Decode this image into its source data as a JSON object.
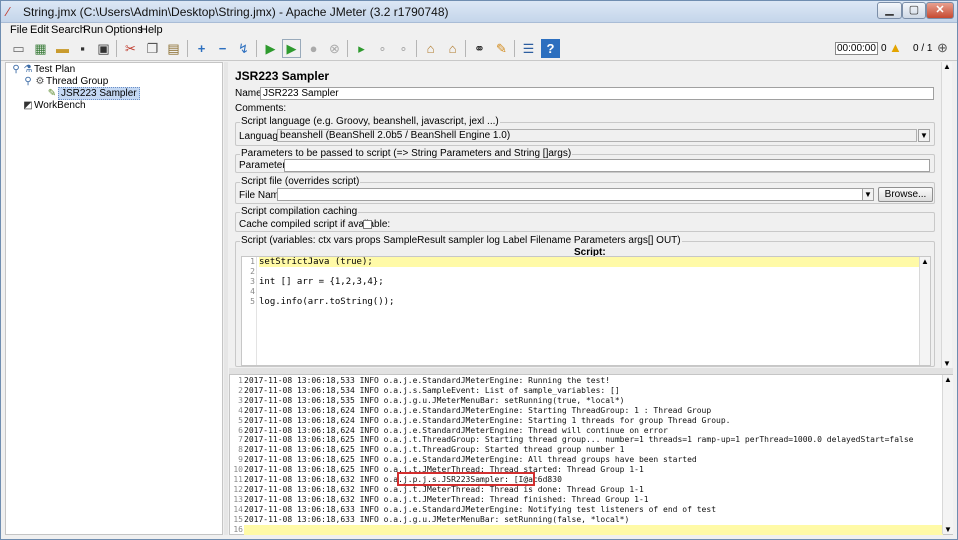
{
  "window": {
    "title": "String.jmx (C:\\Users\\Admin\\Desktop\\String.jmx) - Apache JMeter (3.2 r1790748)",
    "controls": {
      "minimize": "▁",
      "maximize": "▢",
      "close": "✕"
    }
  },
  "menu": [
    "File",
    "Edit",
    "Search",
    "Run",
    "Options",
    "Help"
  ],
  "toolbar": {
    "icons": [
      "new-icon",
      "templates-icon",
      "open-icon",
      "save-icon",
      "save-as-icon",
      "cut-icon",
      "copy-icon",
      "paste-icon",
      "expand-icon",
      "collapse-icon",
      "toggle-icon",
      "start-icon",
      "start-no-pause-icon",
      "stop-icon",
      "shutdown-icon",
      "remote-start-icon",
      "remote-stop-icon",
      "remote-shutdown-icon",
      "clear-icon",
      "clear-all-icon",
      "search-icon",
      "reset-search-icon",
      "function-helper-icon",
      "help-icon"
    ],
    "timer": "00:00:00",
    "warnings_count": "0",
    "threads": "0 / 1"
  },
  "tree": {
    "items": [
      {
        "label": "Test Plan",
        "icon": "test-plan-icon",
        "expander": "⚲"
      },
      {
        "label": "Thread Group",
        "icon": "thread-group-icon",
        "expander": "⚲"
      },
      {
        "label": "JSR223 Sampler",
        "icon": "sampler-icon"
      },
      {
        "label": "WorkBench",
        "icon": "workbench-icon"
      }
    ]
  },
  "sampler": {
    "title": "JSR223 Sampler",
    "name_label": "Name:",
    "name_value": "JSR223 Sampler",
    "comments_label": "Comments:",
    "language_group": "Script language (e.g. Groovy, beanshell, javascript, jexl ...)",
    "language_label": "Language:",
    "language_value": "beanshell     (BeanShell 2.0b5 / BeanShell Engine 1.0)",
    "params_group": "Parameters to be passed to script (=> String Parameters and String []args)",
    "params_label": "Parameters:",
    "file_group": "Script file (overrides script)",
    "file_label": "File Name:",
    "browse_label": "Browse...",
    "caching_group": "Script compilation caching",
    "cache_label": "Cache compiled script if available:",
    "script_group": "Script (variables: ctx vars props SampleResult sampler log Label Filename Parameters args[] OUT)",
    "script_header": "Script:"
  },
  "script_lines": [
    "setStrictJava (true);",
    "",
    "int [] arr = {1,2,3,4};",
    "",
    "log.info(arr.toString());"
  ],
  "log_lines": [
    "2017-11-08 13:06:18,533 INFO o.a.j.e.StandardJMeterEngine: Running the test!",
    "2017-11-08 13:06:18,534 INFO o.a.j.s.SampleEvent: List of sample_variables: []",
    "2017-11-08 13:06:18,535 INFO o.a.j.g.u.JMeterMenuBar: setRunning(true, *local*)",
    "2017-11-08 13:06:18,624 INFO o.a.j.e.StandardJMeterEngine: Starting ThreadGroup: 1 : Thread Group",
    "2017-11-08 13:06:18,624 INFO o.a.j.e.StandardJMeterEngine: Starting 1 threads for group Thread Group.",
    "2017-11-08 13:06:18,624 INFO o.a.j.e.StandardJMeterEngine: Thread will continue on error",
    "2017-11-08 13:06:18,625 INFO o.a.j.t.ThreadGroup: Starting thread group... number=1 threads=1 ramp-up=1 perThread=1000.0 delayedStart=false",
    "2017-11-08 13:06:18,625 INFO o.a.j.t.ThreadGroup: Started thread group number 1",
    "2017-11-08 13:06:18,625 INFO o.a.j.e.StandardJMeterEngine: All thread groups have been started",
    "2017-11-08 13:06:18,625 INFO o.a.j.t.JMeterThread: Thread started: Thread Group 1-1",
    "2017-11-08 13:06:18,632 INFO o.a.j.p.j.s.JSR223Sampler: [I@ac6d830",
    "2017-11-08 13:06:18,632 INFO o.a.j.t.JMeterThread: Thread is done: Thread Group 1-1",
    "2017-11-08 13:06:18,632 INFO o.a.j.t.JMeterThread: Thread finished: Thread Group 1-1",
    "2017-11-08 13:06:18,633 INFO o.a.j.e.StandardJMeterEngine: Notifying test listeners of end of test",
    "2017-11-08 13:06:18,633 INFO o.a.j.g.u.JMeterMenuBar: setRunning(false, *local*)",
    ""
  ]
}
